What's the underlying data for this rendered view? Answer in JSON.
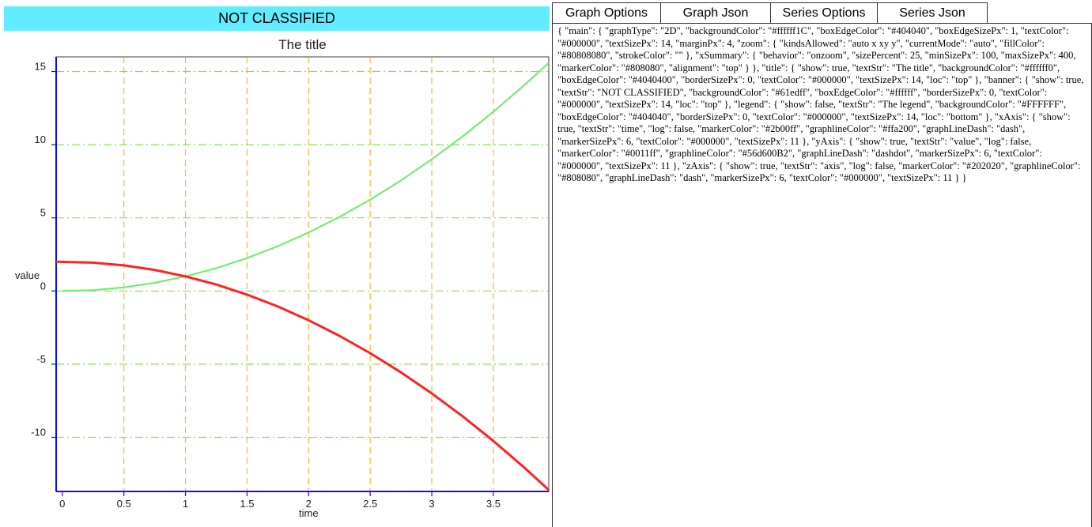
{
  "banner": {
    "text": "NOT CLASSIFIED",
    "color": "#61edff"
  },
  "tabs": [
    {
      "label": "Graph Options",
      "active": false
    },
    {
      "label": "Graph Json",
      "active": true
    },
    {
      "label": "Series Options",
      "active": false
    },
    {
      "label": "Series Json",
      "active": false
    }
  ],
  "json_panel": {
    "text": "{ \"main\": { \"graphType\": \"2D\", \"backgroundColor\": \"#ffffff1C\", \"boxEdgeColor\": \"#404040\", \"boxEdgeSizePx\": 1, \"textColor\": \"#000000\", \"textSizePx\": 14, \"marginPx\": 4, \"zoom\": { \"kindsAllowed\": \"auto x xy y\", \"currentMode\": \"auto\", \"fillColor\": \"#80808080\", \"strokeColor\": \"\" }, \"xSummary\": { \"behavior\": \"onzoom\", \"sizePercent\": 25, \"minSizePx\": 100, \"maxSizePx\": 400, \"markerColor\": \"#808080\", \"alignment\": \"top\" } }, \"title\": { \"show\": true, \"textStr\": \"The title\", \"backgroundColor\": \"#ffffff0\", \"boxEdgeColor\": \"#4040400\", \"borderSizePx\": 0, \"textColor\": \"#000000\", \"textSizePx\": 14, \"loc\": \"top\" }, \"banner\": { \"show\": true, \"textStr\": \"NOT CLASSIFIED\", \"backgroundColor\": \"#61edff\", \"boxEdgeColor\": \"#ffffff\", \"borderSizePx\": 0, \"textColor\": \"#000000\", \"textSizePx\": 14, \"loc\": \"top\" }, \"legend\": { \"show\": false, \"textStr\": \"The legend\", \"backgroundColor\": \"#FFFFFF\", \"boxEdgeColor\": \"#404040\", \"borderSizePx\": 0, \"textColor\": \"#000000\", \"textSizePx\": 14, \"loc\": \"bottom\" }, \"xAxis\": { \"show\": true, \"textStr\": \"time\", \"log\": false, \"markerColor\": \"#2b00ff\", \"graphlineColor\": \"#ffa200\", \"graphLineDash\": \"dash\", \"markerSizePx\": 6, \"textColor\": \"#000000\", \"textSizePx\": 11 }, \"yAxis\": { \"show\": true, \"textStr\": \"value\", \"log\": false, \"markerColor\": \"#0011ff\", \"graphlineColor\": \"#56d600B2\", \"graphLineDash\": \"dashdot\", \"markerSizePx\": 6, \"textColor\": \"#000000\", \"textSizePx\": 11 }, \"zAxis\": { \"show\": true, \"textStr\": \"axis\", \"log\": false, \"markerColor\": \"#202020\", \"graphlineColor\": \"#808080\", \"graphLineDash\": \"dash\", \"markerSizePx\": 6, \"textColor\": \"#000000\", \"textSizePx\": 11 } }"
  },
  "chart_data": {
    "type": "line",
    "title": "The title",
    "xlabel": "time",
    "ylabel": "value",
    "xlim": [
      -0.05,
      3.95
    ],
    "ylim": [
      -13.7,
      16.0
    ],
    "xticks": [
      0,
      0.5,
      1,
      1.5,
      2,
      2.5,
      3,
      3.5
    ],
    "xtick_labels": [
      "0",
      "0.5",
      "1",
      "1.5",
      "2",
      "2.5",
      "3",
      "3.5"
    ],
    "yticks": [
      15,
      10,
      5,
      0,
      -5,
      -10
    ],
    "ytick_labels": [
      "15",
      "10",
      "5",
      "0",
      "-5",
      "-10"
    ],
    "grid": true,
    "colors": {
      "x_axis_marker": "#2b00ff",
      "x_grid": "#ffa200",
      "y_axis_marker": "#0011ff",
      "y_grid": "#56d600",
      "box_edge": "#404040"
    },
    "series": [
      {
        "color": "#66ee66",
        "x": [
          0,
          0.25,
          0.5,
          0.75,
          1,
          1.25,
          1.5,
          1.75,
          2,
          2.25,
          2.5,
          2.75,
          3,
          3.25,
          3.5,
          3.75,
          3.95
        ],
        "values": [
          0,
          0.06,
          0.25,
          0.56,
          1.0,
          1.56,
          2.25,
          3.06,
          4.0,
          5.06,
          6.25,
          7.56,
          9.0,
          10.56,
          12.25,
          14.06,
          15.6
        ]
      },
      {
        "color": "#ff2222",
        "x": [
          -0.05,
          0.25,
          0.5,
          0.75,
          1,
          1.25,
          1.5,
          1.75,
          2,
          2.25,
          2.5,
          2.75,
          3,
          3.25,
          3.5,
          3.75,
          3.95
        ],
        "values": [
          2.0,
          1.94,
          1.75,
          1.44,
          1.0,
          0.44,
          -0.25,
          -1.06,
          -2.0,
          -3.06,
          -4.25,
          -5.56,
          -7.0,
          -8.56,
          -10.25,
          -12.06,
          -13.6
        ]
      }
    ]
  }
}
